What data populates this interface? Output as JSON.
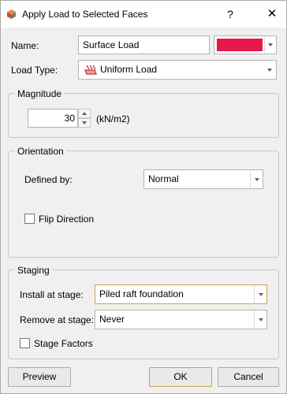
{
  "window": {
    "title": "Apply Load to Selected Faces",
    "help_label": "?",
    "close_label": "✕"
  },
  "name_row": {
    "label": "Name:",
    "value": "Surface Load",
    "color": "#e8174b"
  },
  "load_type": {
    "label": "Load Type:",
    "value": "Uniform Load"
  },
  "magnitude": {
    "group_title": "Magnitude",
    "value": "30",
    "unit": "(kN/m2)"
  },
  "orientation": {
    "group_title": "Orientation",
    "defined_by_label": "Defined by:",
    "defined_by_value": "Normal",
    "flip_label": "Flip Direction",
    "flip_checked": false
  },
  "staging": {
    "group_title": "Staging",
    "install_label": "Install at stage:",
    "install_value": "Piled raft foundation",
    "remove_label": "Remove at stage:",
    "remove_value": "Never",
    "factors_label": "Stage Factors",
    "factors_checked": false
  },
  "buttons": {
    "preview": "Preview",
    "ok": "OK",
    "cancel": "Cancel"
  }
}
